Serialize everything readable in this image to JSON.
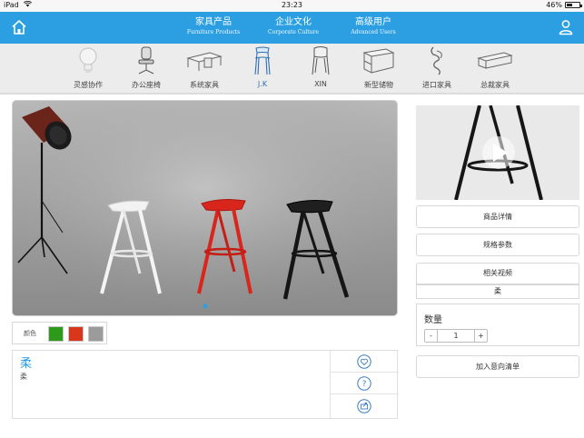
{
  "statusbar": {
    "device": "iPad",
    "time": "23:23",
    "battery": "46%",
    "battery_level": 0.46
  },
  "nav": {
    "items": [
      {
        "cn": "家具产品",
        "en": "Furniture Products"
      },
      {
        "cn": "企业文化",
        "en": "Corporate Culture"
      },
      {
        "cn": "高级用户",
        "en": "Advanced Users"
      }
    ]
  },
  "categories": [
    {
      "label": "灵感协作",
      "icon": "bulb-icon"
    },
    {
      "label": "办公座椅",
      "icon": "office-chair-icon"
    },
    {
      "label": "系统家具",
      "icon": "desk-system-icon"
    },
    {
      "label": "J.K",
      "icon": "chair-jk-icon",
      "active": true
    },
    {
      "label": "XIN",
      "icon": "chair-xin-icon"
    },
    {
      "label": "新型储物",
      "icon": "storage-icon"
    },
    {
      "label": "进口家具",
      "icon": "lounge-chair-icon"
    },
    {
      "label": "总裁家具",
      "icon": "executive-desk-icon"
    }
  ],
  "colors": {
    "label": "颜色",
    "swatches": [
      "#2e9a1c",
      "#d8371c",
      "#9b9b9b"
    ]
  },
  "product": {
    "title": "柔",
    "subtitle": "柔"
  },
  "right": {
    "details": "商品详情",
    "specs": "规格参数",
    "video": "相关视频",
    "video_sub": "柔",
    "qty_label": "数量",
    "qty_minus": "-",
    "qty_value": "1",
    "qty_plus": "+",
    "add_to_list": "加入意向清单"
  },
  "theme": {
    "accent": "#2b9fe2"
  }
}
